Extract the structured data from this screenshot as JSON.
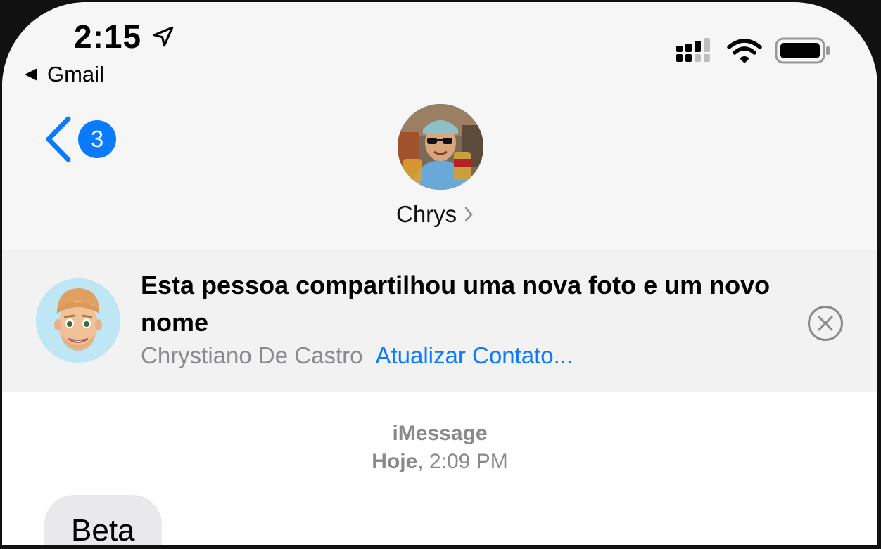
{
  "status_bar": {
    "time": "2:15",
    "back_app_label": "Gmail"
  },
  "nav": {
    "unread_count": "3",
    "contact_name": "Chrys"
  },
  "banner": {
    "title": "Esta pessoa compartilhou uma nova foto e um novo nome",
    "sender_name": "Chrystiano De Castro",
    "action_link": "Atualizar Contato..."
  },
  "conversation": {
    "service_label": "iMessage",
    "timestamp_day": "Hoje",
    "timestamp_time": ", 2:09 PM",
    "messages": [
      {
        "text": "Beta",
        "direction": "incoming"
      }
    ]
  },
  "colors": {
    "accent": "#0a7aff",
    "secondary_text": "#8a8a8e",
    "bubble_incoming": "#e9e9eb"
  }
}
